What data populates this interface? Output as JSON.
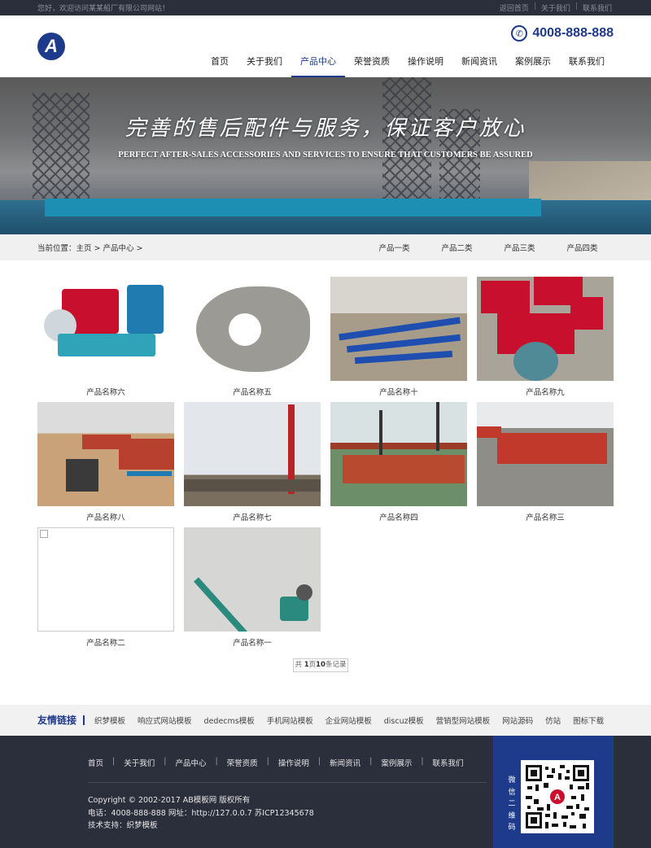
{
  "topbar": {
    "welcome": "您好，欢迎访问某某船厂有限公司网站！",
    "links": [
      "返回首页",
      "关于我们",
      "联系我们"
    ]
  },
  "header": {
    "logo_letter": "A",
    "phone": "4008-888-888",
    "nav": [
      {
        "label": "首页",
        "active": false
      },
      {
        "label": "关于我们",
        "active": false
      },
      {
        "label": "产品中心",
        "active": true
      },
      {
        "label": "荣誉资质",
        "active": false
      },
      {
        "label": "操作说明",
        "active": false
      },
      {
        "label": "新闻资讯",
        "active": false
      },
      {
        "label": "案例展示",
        "active": false
      },
      {
        "label": "联系我们",
        "active": false
      }
    ]
  },
  "banner": {
    "title": "完善的售后配件与服务，保证客户放心",
    "subtitle": "PERFECT AFTER-SALES ACCESSORIES AND SERVICES TO ENSURE THAT CUSTOMERS BE ASSURED"
  },
  "breadcrumb": {
    "text": "当前位置：主页 > 产品中心 >",
    "categories": [
      "产品一类",
      "产品二类",
      "产品三类",
      "产品四类"
    ]
  },
  "products": [
    {
      "name": "产品名称六",
      "kind": "engine-red-teal"
    },
    {
      "name": "产品名称五",
      "kind": "pump-housing"
    },
    {
      "name": "产品名称十",
      "kind": "blue-pipes"
    },
    {
      "name": "产品名称九",
      "kind": "red-engines-row"
    },
    {
      "name": "产品名称八",
      "kind": "yard-engine"
    },
    {
      "name": "产品名称七",
      "kind": "crane-tower"
    },
    {
      "name": "产品名称四",
      "kind": "red-boat-water"
    },
    {
      "name": "产品名称三",
      "kind": "red-hull-yard"
    },
    {
      "name": "产品名称二",
      "kind": "broken-image"
    },
    {
      "name": "产品名称一",
      "kind": "teal-shaft"
    }
  ],
  "pagination": {
    "prefix": "共 ",
    "pages": "1",
    "mid": "页",
    "records": "10",
    "suffix": "条记录"
  },
  "friend_links": {
    "label": "友情链接",
    "items": [
      "织梦模板",
      "响应式网站模板",
      "dedecms模板",
      "手机网站模板",
      "企业网站模板",
      "discuz模板",
      "营销型网站模板",
      "网站源码",
      "仿站",
      "图标下载"
    ]
  },
  "footer": {
    "nav": [
      "首页",
      "关于我们",
      "产品中心",
      "荣誉资质",
      "操作说明",
      "新闻资讯",
      "案例展示",
      "联系我们"
    ],
    "copyright": "Copyright © 2002-2017 AB模板网 版权所有",
    "contact": "电话：4008-888-888 网址：http://127.0.0.7 苏ICP12345678",
    "support": "技术支持：织梦模板",
    "qr_label": "微信二维码"
  },
  "colors": {
    "brand": "#1e3a8a",
    "dark": "#2b2f3b"
  }
}
